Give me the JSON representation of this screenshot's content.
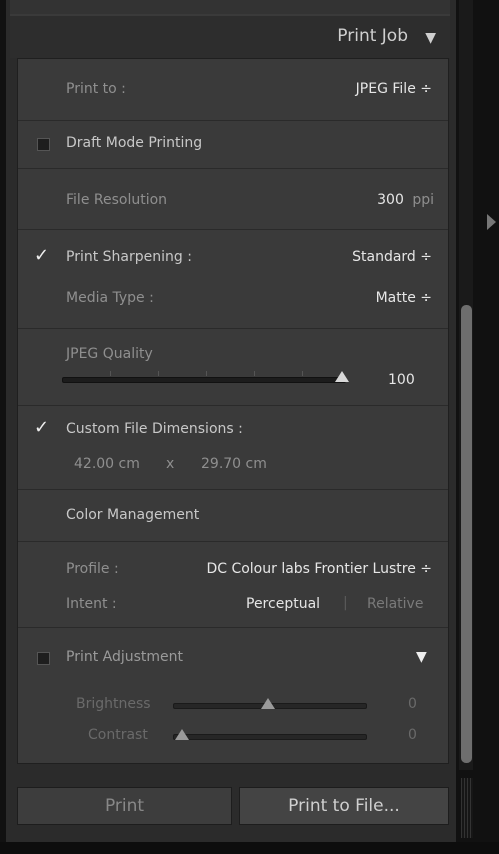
{
  "section": {
    "title": "Print Job",
    "collapse_icon": "triangle-down-icon"
  },
  "print_to": {
    "label": "Print to :",
    "value": "JPEG File ÷"
  },
  "draft_mode": {
    "label": "Draft Mode Printing",
    "checked": false
  },
  "file_resolution": {
    "label": "File Resolution",
    "value": "300",
    "unit": "ppi"
  },
  "sharpening": {
    "label": "Print Sharpening :",
    "value": "Standard ÷",
    "checked": true
  },
  "media_type": {
    "label": "Media Type :",
    "value": "Matte ÷"
  },
  "jpeg_quality": {
    "label": "JPEG Quality",
    "value": "100",
    "level_percent": 100
  },
  "custom_dims": {
    "label": "Custom File Dimensions :",
    "checked": true,
    "width": "42.00 cm",
    "x": "x",
    "height": "29.70 cm"
  },
  "color_mgmt": {
    "heading": "Color Management",
    "profile_label": "Profile :",
    "profile_value": "DC Colour labs Frontier Lustre ÷",
    "intent_label": "Intent :",
    "intent_perceptual": "Perceptual",
    "intent_divider": "|",
    "intent_relative": "Relative"
  },
  "print_adjustment": {
    "label": "Print Adjustment",
    "checked": false,
    "brightness_label": "Brightness",
    "brightness_value": "0",
    "contrast_label": "Contrast",
    "contrast_value": "0"
  },
  "buttons": {
    "print": "Print",
    "print_to_file": "Print to File..."
  }
}
